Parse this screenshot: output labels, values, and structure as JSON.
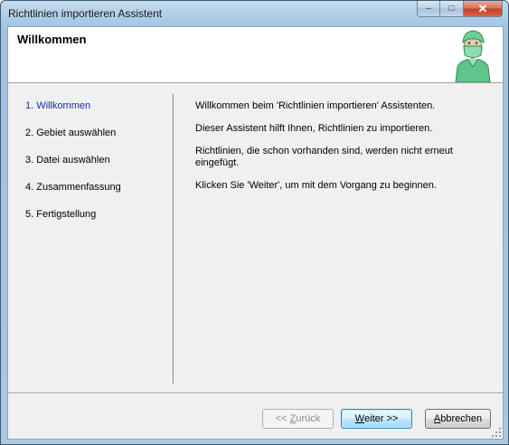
{
  "window": {
    "title": "Richtlinien importieren Assistent",
    "controls": {
      "minimize": "‒",
      "maximize": "□",
      "close": "✕"
    }
  },
  "header": {
    "title": "Willkommen",
    "figure_icon": "wizard-figure-icon"
  },
  "steps": [
    {
      "label": "1. Willkommen",
      "active": true
    },
    {
      "label": "2. Gebiet auswählen",
      "active": false
    },
    {
      "label": "3. Datei auswählen",
      "active": false
    },
    {
      "label": "4. Zusammenfassung",
      "active": false
    },
    {
      "label": "5. Fertigstellung",
      "active": false
    }
  ],
  "content": {
    "paragraphs": [
      "Willkommen beim 'Richtlinien importieren' Assistenten.",
      "Dieser Assistent hilft Ihnen, Richtlinien zu importieren.",
      "Richtlinien, die schon vorhanden sind, werden nicht erneut eingefügt.",
      "Klicken Sie 'Weiter', um mit dem Vorgang zu beginnen."
    ]
  },
  "buttons": {
    "back": {
      "prefix": "<< ",
      "mnemonic": "Z",
      "rest": "urück",
      "enabled": false
    },
    "next": {
      "mnemonic": "W",
      "rest": "eiter >>",
      "enabled": true
    },
    "cancel": {
      "mnemonic": "A",
      "rest": "bbrechen",
      "enabled": true
    }
  },
  "colors": {
    "active_step": "#1b2ab0",
    "figure_green": "#5fc489"
  }
}
